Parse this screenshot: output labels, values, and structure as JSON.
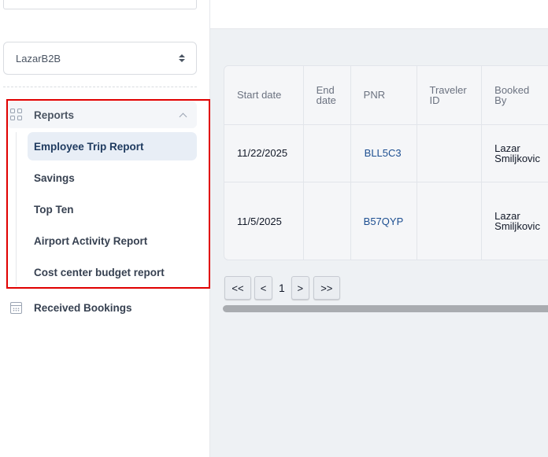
{
  "sidebar": {
    "account_select": {
      "value": "LazarB2B"
    },
    "reports": {
      "label": "Reports",
      "icon": "grid-icon",
      "items": [
        {
          "label": "Employee Trip Report",
          "active": true
        },
        {
          "label": "Savings",
          "active": false
        },
        {
          "label": "Top Ten",
          "active": false
        },
        {
          "label": "Airport Activity Report",
          "active": false
        },
        {
          "label": "Cost center budget report",
          "active": false
        }
      ]
    },
    "received_bookings": {
      "label": "Received Bookings",
      "icon": "calendar-icon"
    }
  },
  "table": {
    "headers": {
      "start_date": "Start date",
      "end_date_1": "End",
      "end_date_2": "date",
      "pnr": "PNR",
      "traveler_id_1": "Traveler",
      "traveler_id_2": "ID",
      "booked_by_1": "Booked",
      "booked_by_2": "By"
    },
    "rows": [
      {
        "start_date": "11/22/2025",
        "end_date": "",
        "pnr": "BLL5C3",
        "traveler_id": "",
        "booked_by_1": "Lazar",
        "booked_by_2": "Smiljkovic"
      },
      {
        "start_date": "11/5/2025",
        "end_date": "",
        "pnr": "B57QYP",
        "traveler_id": "",
        "booked_by_1": "Lazar",
        "booked_by_2": "Smiljkovic"
      }
    ]
  },
  "pagination": {
    "first": "<<",
    "prev": "<",
    "page": "1",
    "next": ">",
    "last": ">>"
  },
  "colors": {
    "highlight": "#e00000",
    "active_bg": "#e8eef6",
    "link": "#1d4f91"
  }
}
